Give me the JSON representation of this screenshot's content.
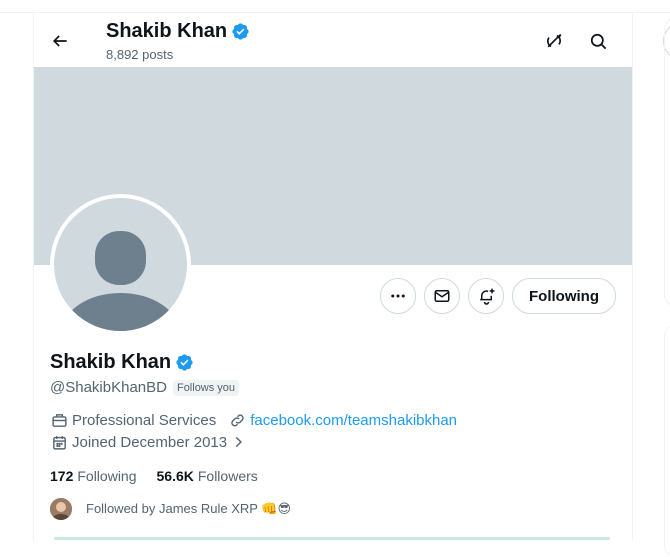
{
  "header": {
    "name": "Shakib Khan",
    "posts": "8,892 posts"
  },
  "profile": {
    "name": "Shakib Khan",
    "handle": "@ShakibKhanBD",
    "follows_you": "Follows you",
    "category": "Professional Services",
    "website": "facebook.com/teamshakibkhan",
    "joined": "Joined December 2013",
    "following_count": "172",
    "following_label": "Following",
    "followers_count": "56.6K",
    "followers_label": "Followers",
    "followed_by": "Followed by James Rule XRP 👊😎"
  },
  "actions": {
    "follow_label": "Following"
  },
  "colors": {
    "accent": "#1d9bf0",
    "banner": "#cfd9de",
    "muted_text": "#536471"
  }
}
